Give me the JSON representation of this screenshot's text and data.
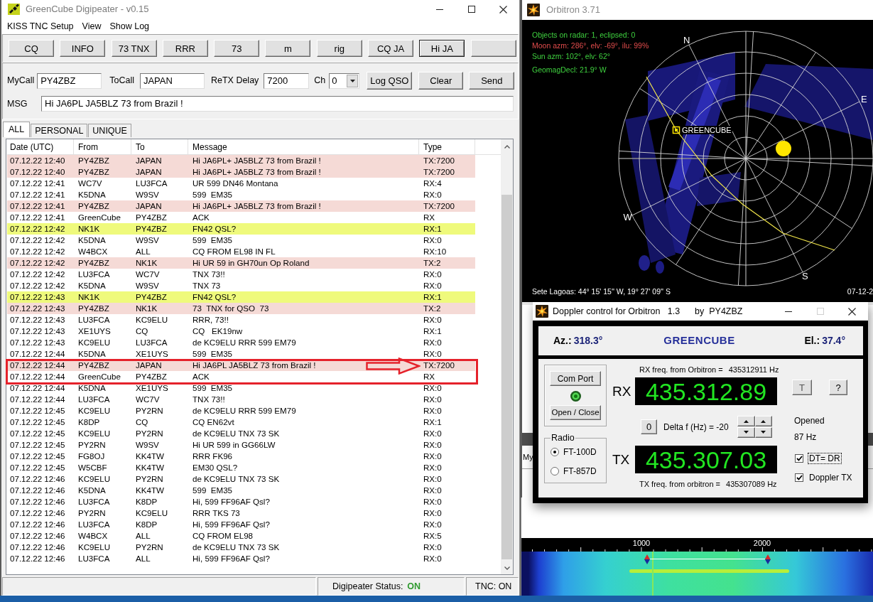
{
  "digipeater": {
    "title": "GreenCube Digipeater - v0.15",
    "menu": [
      "KISS TNC Setup",
      "View",
      "Show Log"
    ],
    "macro_buttons": [
      {
        "label": "CQ",
        "focused": false
      },
      {
        "label": "INFO",
        "focused": false
      },
      {
        "label": "73 TNX",
        "focused": false
      },
      {
        "label": "RRR",
        "focused": false
      },
      {
        "label": "73",
        "focused": false
      },
      {
        "label": "m",
        "focused": false
      },
      {
        "label": "rig",
        "focused": false
      },
      {
        "label": "CQ JA",
        "focused": false
      },
      {
        "label": "Hi JA",
        "focused": true
      },
      {
        "focused": false
      }
    ],
    "call_fields": [
      {
        "label": "MyCall",
        "value": "PY4ZBZ"
      },
      {
        "label": "ToCall",
        "value": "JAPAN"
      },
      {
        "label": "ReTX Delay",
        "value": "7200"
      }
    ],
    "channel": {
      "label": "Ch",
      "value": "0"
    },
    "action_buttons": [
      "Log QSO",
      "Clear",
      "Send"
    ],
    "message": {
      "label": "MSG",
      "value": "Hi JA6PL JA5BLZ 73 from Brazil !"
    },
    "tabs": [
      {
        "label": "ALL",
        "selected": true
      },
      {
        "label": "PERSONAL",
        "selected": false
      },
      {
        "label": "UNIQUE",
        "selected": false
      }
    ],
    "table": {
      "columns": [
        "Date (UTC)",
        "From",
        "To",
        "Message",
        "Type"
      ],
      "rows": [
        {
          "cells": [
            "07.12.22 12:40",
            "PY4ZBZ",
            "JAPAN",
            "Hi JA6PL+ JA5BLZ 73 from Brazil !",
            "TX:7200"
          ],
          "color": "#f5dad6"
        },
        {
          "cells": [
            "07.12.22 12:40",
            "PY4ZBZ",
            "JAPAN",
            "Hi JA6PL+ JA5BLZ 73 from Brazil !",
            "TX:7200"
          ],
          "color": "#f5dad6"
        },
        {
          "cells": [
            "07.12.22 12:41",
            "WC7V",
            "LU3FCA",
            "UR 599 DN46 Montana",
            "RX:4"
          ]
        },
        {
          "cells": [
            "07.12.22 12:41",
            "K5DNA",
            "W9SV",
            "599  EM35",
            "RX:0"
          ]
        },
        {
          "cells": [
            "07.12.22 12:41",
            "PY4ZBZ",
            "JAPAN",
            "Hi JA6PL+ JA5BLZ 73 from Brazil !",
            "TX:7200"
          ],
          "color": "#f5dad6"
        },
        {
          "cells": [
            "07.12.22 12:41",
            "GreenCube",
            "PY4ZBZ",
            "ACK",
            "RX"
          ]
        },
        {
          "cells": [
            "07.12.22 12:42",
            "NK1K",
            "PY4ZBZ",
            "FN42 QSL?",
            "RX:1"
          ],
          "color": "#effa7c"
        },
        {
          "cells": [
            "07.12.22 12:42",
            "K5DNA",
            "W9SV",
            "599  EM35",
            "RX:0"
          ]
        },
        {
          "cells": [
            "07.12.22 12:42",
            "W4BCX",
            "ALL",
            "CQ FROM EL98 IN FL",
            "RX:10"
          ]
        },
        {
          "cells": [
            "07.12.22 12:42",
            "PY4ZBZ",
            "NK1K",
            "Hi UR 59 in GH70un Op Roland",
            "TX:2"
          ],
          "color": "#f5dad6"
        },
        {
          "cells": [
            "07.12.22 12:42",
            "LU3FCA",
            "WC7V",
            "TNX 73!!",
            "RX:0"
          ]
        },
        {
          "cells": [
            "07.12.22 12:42",
            "K5DNA",
            "W9SV",
            "TNX 73",
            "RX:0"
          ]
        },
        {
          "cells": [
            "07.12.22 12:43",
            "NK1K",
            "PY4ZBZ",
            "FN42 QSL?",
            "RX:1"
          ],
          "color": "#effa7c"
        },
        {
          "cells": [
            "07.12.22 12:43",
            "PY4ZBZ",
            "NK1K",
            "73  TNX for QSO  73",
            "TX:2"
          ],
          "color": "#f5dad6"
        },
        {
          "cells": [
            "07.12.22 12:43",
            "LU3FCA",
            "KC9ELU",
            "RRR, 73!!",
            "RX:0"
          ]
        },
        {
          "cells": [
            "07.12.22 12:43",
            "XE1UYS",
            "CQ",
            "CQ   EK19nw",
            "RX:1"
          ]
        },
        {
          "cells": [
            "07.12.22 12:43",
            "KC9ELU",
            "LU3FCA",
            "de KC9ELU RRR 599 EM79",
            "RX:0"
          ]
        },
        {
          "cells": [
            "07.12.22 12:44",
            "K5DNA",
            "XE1UYS",
            "599  EM35",
            "RX:0"
          ]
        },
        {
          "cells": [
            "07.12.22 12:44",
            "PY4ZBZ",
            "JAPAN",
            "Hi JA6PL JA5BLZ 73 from Brazil !",
            "TX:7200"
          ],
          "color": "#f5dad6"
        },
        {
          "cells": [
            "07.12.22 12:44",
            "GreenCube",
            "PY4ZBZ",
            "ACK",
            "RX"
          ]
        },
        {
          "cells": [
            "07.12.22 12:44",
            "K5DNA",
            "XE1UYS",
            "599  EM35",
            "RX:0"
          ]
        },
        {
          "cells": [
            "07.12.22 12:44",
            "LU3FCA",
            "WC7V",
            "TNX 73!!",
            "RX:0"
          ]
        },
        {
          "cells": [
            "07.12.22 12:45",
            "KC9ELU",
            "PY2RN",
            "de KC9ELU RRR 599 EM79",
            "RX:0"
          ]
        },
        {
          "cells": [
            "07.12.22 12:45",
            "K8DP",
            "CQ",
            "CQ EN62vt",
            "RX:1"
          ]
        },
        {
          "cells": [
            "07.12.22 12:45",
            "KC9ELU",
            "PY2RN",
            "de KC9ELU TNX 73 SK",
            "RX:0"
          ]
        },
        {
          "cells": [
            "07.12.22 12:45",
            "PY2RN",
            "W9SV",
            "Hi UR 599 in GG66LW",
            "RX:0"
          ]
        },
        {
          "cells": [
            "07.12.22 12:45",
            "FG8OJ",
            "KK4TW",
            "RRR FK96",
            "RX:0"
          ]
        },
        {
          "cells": [
            "07.12.22 12:45",
            "W5CBF",
            "KK4TW",
            "EM30 QSL?",
            "RX:0"
          ]
        },
        {
          "cells": [
            "07.12.22 12:46",
            "KC9ELU",
            "PY2RN",
            "de KC9ELU TNX 73 SK",
            "RX:0"
          ]
        },
        {
          "cells": [
            "07.12.22 12:46",
            "K5DNA",
            "KK4TW",
            "599  EM35",
            "RX:0"
          ]
        },
        {
          "cells": [
            "07.12.22 12:46",
            "LU3FCA",
            "K8DP",
            "Hi, 599 FF96AF Qsl?",
            "RX:0"
          ]
        },
        {
          "cells": [
            "07.12.22 12:46",
            "PY2RN",
            "KC9ELU",
            "RRR TKS 73",
            "RX:0"
          ]
        },
        {
          "cells": [
            "07.12.22 12:46",
            "LU3FCA",
            "K8DP",
            "Hi, 599 FF96AF Qsl?",
            "RX:0"
          ]
        },
        {
          "cells": [
            "07.12.22 12:46",
            "W4BCX",
            "ALL",
            "CQ FROM EL98",
            "RX:5"
          ]
        },
        {
          "cells": [
            "07.12.22 12:46",
            "KC9ELU",
            "PY2RN",
            "de KC9ELU TNX 73 SK",
            "RX:0"
          ]
        },
        {
          "cells": [
            "07.12.22 12:46",
            "LU3FCA",
            "ALL",
            "Hi, 599 FF96AF Qsl?",
            "RX:0"
          ]
        }
      ]
    },
    "status_bar": {
      "label": "Digipeater Status:",
      "value": "ON",
      "tnc": "TNC: ON"
    }
  },
  "orbitron": {
    "title": "Orbitron 3.71",
    "info_lines": [
      {
        "text": "Objects on radar: 1, eclipsed: 0",
        "color": "#3fd13f"
      },
      {
        "text": "Moon azm: 286°, elv: -69°, ilu: 99%",
        "color": "#e24c4c"
      },
      {
        "text": "Sun azm: 102°, elv: 62°",
        "color": "#3fd13f"
      },
      {
        "text": "GeomagDecl: 21.9° W",
        "color": "#3fd13f"
      }
    ],
    "compass": [
      "N",
      "E",
      "S",
      "W"
    ],
    "satellite_label": "GREENCUBE",
    "location": "Sete Lagoas: 44° 15' 15'' W, 19° 27' 09'' S",
    "date": "07-12-2",
    "panel_text": "My"
  },
  "doppler": {
    "title": "Doppler control for Orbitron   1.3      by  PY4ZBZ",
    "maximize_disabled": true,
    "azimuth": {
      "label": "Az.:",
      "value": "318.3°"
    },
    "satellite": "GREENCUBE",
    "elevation": {
      "label": "El.:",
      "value": "37.4°"
    },
    "port_buttons": [
      "Com Port",
      "Open / Close"
    ],
    "port_led_on": true,
    "radio": {
      "label": "Radio",
      "options": [
        {
          "label": "FT-100D",
          "selected": true
        },
        {
          "label": "FT-857D",
          "selected": false
        }
      ]
    },
    "rx": {
      "label": "RX",
      "caption": "RX freq. from Orbitron =",
      "frequency": "435312911 Hz",
      "display": "435.312.89"
    },
    "zero_button": "0",
    "delta": "Delta f (Hz) = -20",
    "tx": {
      "label": "TX",
      "caption": "TX freq. from orbitron =",
      "frequency": "435307089 Hz",
      "display": "435.307.03"
    },
    "side_buttons": [
      "T",
      "?"
    ],
    "status": "Opened",
    "offset": "87 Hz",
    "checkboxes": [
      {
        "label": "DT= DR",
        "checked": true,
        "focused": true
      },
      {
        "label": "Doppler TX",
        "checked": true,
        "focused": false
      }
    ]
  },
  "waterfall": {
    "scale_labels": [
      "1000",
      "2000"
    ]
  }
}
